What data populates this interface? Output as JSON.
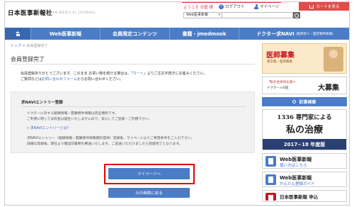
{
  "header": {
    "logo": "日本医事新報社",
    "logo_sub": "JAPAN MEDICAL JOURNAL",
    "welcome": "ようこそ 日医 様",
    "logout": "ログアウト",
    "mypage": "マイページ",
    "cart": "カートを見る",
    "search_category": "Web医事新報"
  },
  "nav": {
    "items": [
      {
        "label": ""
      },
      {
        "label": "Web医事新報"
      },
      {
        "label": "会員限定コンテンツ"
      },
      {
        "label": "書籍・jmedmook"
      },
      {
        "label": "ドクター求NAVI",
        "small": "(医師求人・医院物件情報)"
      }
    ]
  },
  "breadcrumb": {
    "top": "トップ",
    "sep": ">",
    "current": "会員登録完了"
  },
  "main": {
    "title": "会員登録完了",
    "msg1_a": "会員登録ありがとうございます。このまま お買い物を続ける場合は、「",
    "msg1_link": "カート",
    "msg1_b": "」よりご注文手続きにお進みください。",
    "msg2_a": "ご質問などは",
    "msg2_link": "お問い合わせフォーム",
    "msg2_b": "からお問い合わせください。"
  },
  "panel": {
    "title": "求NAVIエントリー登録",
    "p1": "ドクターに対する組織情報・開業物件情報は完全無料です。",
    "p2": "ご利用に際しては料金は発生いたしませんので、安心してご登録・ご利用下さい。",
    "link": "» 求NAVIエントリーとは？",
    "p3": "求NAVIエントリー（組織情報・開業物件情報無料提供）登録後、マイページよりご希望条件をご入力下さい。",
    "p4": "詳細な登録後、弊社より確認印書類を郵送いたします。ご返送いただけましたら登録完了となります。"
  },
  "buttons": {
    "mypage": "マイページへ",
    "back": "元の画面に戻る"
  },
  "sidebar": {
    "ad1_title": "医師募集",
    "ad1_sub": "東京都・医師募集",
    "ad2_sub": "「私を主体的な道へ",
    "ad2_title": "大募集",
    "ad2_t2": "ドクター×日医",
    "article": "記事検索",
    "book_l1": "1336 専門家による",
    "book_l2": "私の治療",
    "book_l3": "2017−18 年度版",
    "wb1_title": "Web医事新報",
    "wb1_sub": "使い方はこちら",
    "wb2_title": "Web医事新報",
    "wb2_sub": "かんたん登録ガイド",
    "wb3_title": "日本医事新報 申込"
  }
}
